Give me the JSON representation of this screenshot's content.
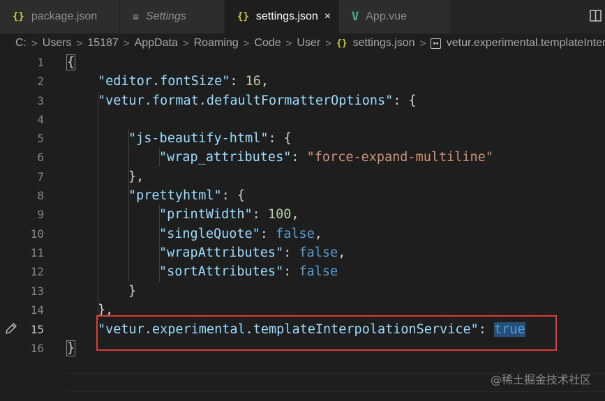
{
  "tabs": [
    {
      "label": "package.json",
      "icon": "json-braces-icon",
      "active": false
    },
    {
      "label": "Settings",
      "icon": "settings-lines-icon",
      "active": false
    },
    {
      "label": "settings.json",
      "icon": "json-braces-icon",
      "active": true,
      "close": "×"
    },
    {
      "label": "App.vue",
      "icon": "vue-logo-icon",
      "active": false
    }
  ],
  "icons": {
    "json": "{}",
    "vue": "V",
    "settings": "≡"
  },
  "breadcrumb": {
    "segments": [
      "C:",
      "Users",
      "15187",
      "AppData",
      "Roaming",
      "Code",
      "User"
    ],
    "separator": ">",
    "file": "settings.json",
    "property": "vetur.experimental.templateInterpolationService"
  },
  "editor": {
    "line_numbers": [
      "1",
      "2",
      "3",
      "4",
      "5",
      "6",
      "7",
      "8",
      "9",
      "10",
      "11",
      "12",
      "13",
      "14",
      "15",
      "16"
    ],
    "current_line": "15",
    "lines": {
      "l1": {
        "brace": "{"
      },
      "l2": {
        "key": "\"editor.fontSize\"",
        "colon": ": ",
        "value": "16",
        "comma": ","
      },
      "l3": {
        "key": "\"vetur.format.defaultFormatterOptions\"",
        "rest": ": {"
      },
      "l5": {
        "key": "\"js-beautify-html\"",
        "rest": ": {"
      },
      "l6": {
        "key": "\"wrap_attributes\"",
        "colon": ": ",
        "value": "\"force-expand-multiline\""
      },
      "l7": {
        "text": "},"
      },
      "l8": {
        "key": "\"prettyhtml\"",
        "rest": ": {"
      },
      "l9": {
        "key": "\"printWidth\"",
        "colon": ": ",
        "value": "100",
        "comma": ","
      },
      "l10": {
        "key": "\"singleQuote\"",
        "colon": ": ",
        "value": "false",
        "comma": ","
      },
      "l11": {
        "key": "\"wrapAttributes\"",
        "colon": ": ",
        "value": "false",
        "comma": ","
      },
      "l12": {
        "key": "\"sortAttributes\"",
        "colon": ": ",
        "value": "false"
      },
      "l13": {
        "text": "}"
      },
      "l14": {
        "text": "},"
      },
      "l15": {
        "key": "\"vetur.experimental.templateInterpolationService\"",
        "colon": ": ",
        "value": "true"
      },
      "l16": {
        "brace": "}"
      }
    }
  },
  "watermark": "@稀土掘金技术社区",
  "colors": {
    "highlight_box": "#e03a3a",
    "key": "#9cdcfe",
    "string": "#ce9178",
    "number": "#b5cea8",
    "boolean": "#569cd6"
  }
}
